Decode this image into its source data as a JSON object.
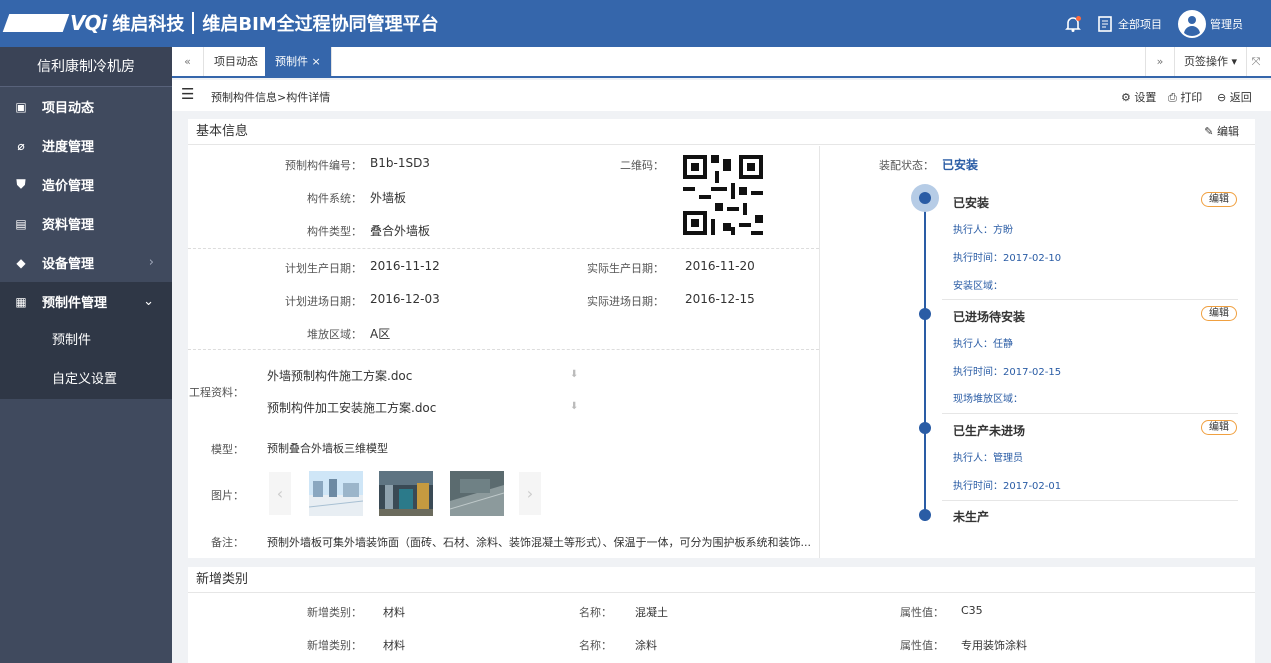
{
  "app": {
    "logo_text": "VQi",
    "company": "维启科技",
    "platform": "维启BIM全过程协同管理平台",
    "all_projects": "全部项目",
    "user": "管理员"
  },
  "sidebar": {
    "project_name": "信利康制冷机房",
    "items": [
      {
        "label": "项目动态",
        "icon": "monitor-icon"
      },
      {
        "label": "进度管理",
        "icon": "paperclip-icon"
      },
      {
        "label": "造价管理",
        "icon": "shield-icon"
      },
      {
        "label": "资料管理",
        "icon": "screen-icon"
      },
      {
        "label": "设备管理",
        "icon": "tag-icon"
      },
      {
        "label": "预制件管理",
        "icon": "document-icon"
      }
    ],
    "subitems": [
      "预制件",
      "自定义设置"
    ]
  },
  "tabs": [
    "项目动态",
    "预制件 ×"
  ],
  "tab_actions": {
    "page_ops": "页签操作 ▾"
  },
  "breadcrumb": "预制构件信息>构件详情",
  "toolbar": {
    "settings": "设置",
    "print": "打印",
    "back": "返回"
  },
  "basic": {
    "title": "基本信息",
    "edit": "编辑",
    "code_label": "预制构件编号：",
    "code": "B1b-1SD3",
    "system_label": "构件系统：",
    "system": "外墙板",
    "type_label": "构件类型：",
    "type": "叠合外墙板",
    "qr_label": "二维码：",
    "plan_prod_label": "计划生产日期：",
    "plan_prod": "2016-11-12",
    "act_prod_label": "实际生产日期：",
    "act_prod": "2016-11-20",
    "plan_in_label": "计划进场日期：",
    "plan_in": "2016-12-03",
    "act_in_label": "实际进场日期：",
    "act_in": "2016-12-15",
    "area_label": "堆放区域：",
    "area": "A区",
    "docs_label": "工程资料：",
    "docs": [
      "外墙预制构件施工方案.doc",
      "预制构件加工安装施工方案.doc"
    ],
    "model_label": "模型：",
    "model": "预制叠合外墙板三维模型",
    "pics_label": "图片：",
    "remark_label": "备注：",
    "remark": "预制外墙板可集外墙装饰面（面砖、石材、涂料、装饰混凝土等形式）、保温于一体，可分为围护板系统和装饰..."
  },
  "status": {
    "label": "装配状态：",
    "value": "已安装",
    "steps": [
      {
        "title": "已安装",
        "edit": "编辑",
        "lines": [
          "执行人：方盼",
          "执行时间：2017-02-10",
          "安装区域："
        ]
      },
      {
        "title": "已进场待安装",
        "edit": "编辑",
        "lines": [
          "执行人：任静",
          "执行时间：2017-02-15",
          "现场堆放区域："
        ]
      },
      {
        "title": "已生产未进场",
        "edit": "编辑",
        "lines": [
          "执行人：管理员",
          "执行时间：2017-02-01"
        ]
      },
      {
        "title": "未生产"
      }
    ]
  },
  "categories": {
    "title": "新增类别",
    "cat_label": "新增类别：",
    "name_label": "名称：",
    "attr_label": "属性值：",
    "rows": [
      {
        "cat": "材料",
        "name": "混凝土",
        "attr": "C35"
      },
      {
        "cat": "材料",
        "name": "涂料",
        "attr": "专用装饰涂料"
      }
    ]
  },
  "colors": {
    "primary": "#3566ab",
    "sidebar": "#404a5e",
    "accent": "#f0a040"
  }
}
